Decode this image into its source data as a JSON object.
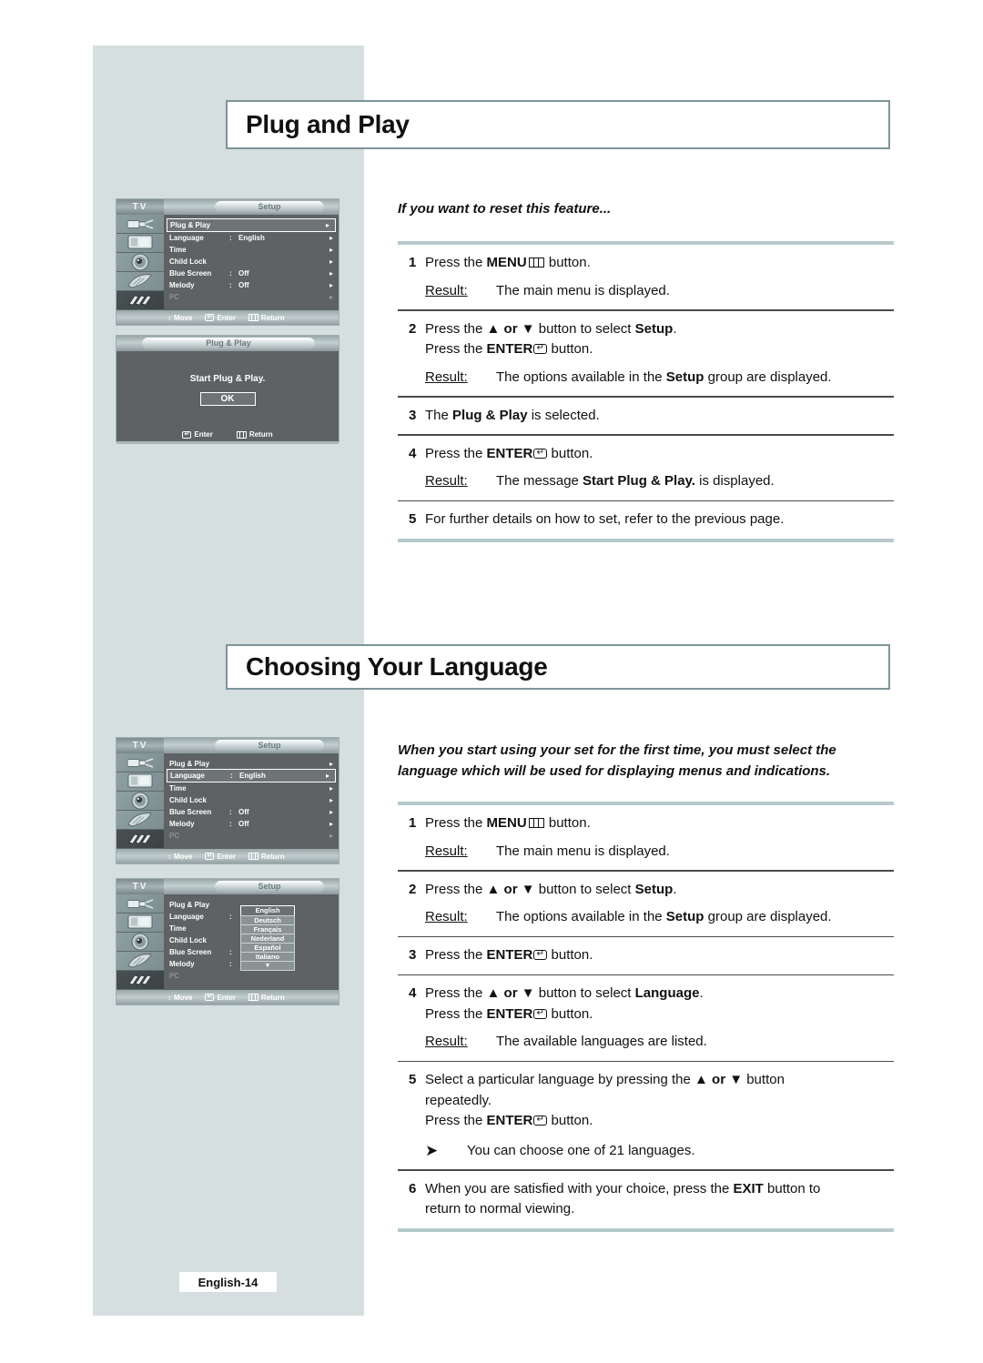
{
  "page": {
    "footer_label": "English-14"
  },
  "sections": [
    {
      "heading": "Plug and Play",
      "intro": "If you want to reset this feature...",
      "steps": [
        {
          "num": "1",
          "lines": [
            "Press the ",
            "MENU",
            " button."
          ],
          "text_pre": "Press the ",
          "bold": "MENU",
          "glyph": "menu-icon",
          "text_post": " button.",
          "result_label": "Result:",
          "result_text": "The main menu is displayed."
        },
        {
          "num": "2",
          "result_label": "Result:",
          "result_text_a": "The options available in the ",
          "result_bold": "Setup",
          "result_text_b": " group are displayed."
        },
        {
          "num": "3",
          "text_a": "The ",
          "bold": "Plug & Play",
          "text_b": " is selected."
        },
        {
          "num": "4",
          "text_pre": "Press the ",
          "bold": "ENTER",
          "text_post": " button.",
          "result_label": "Result:",
          "result_text_a": "The message ",
          "result_bold": "Start Plug & Play.",
          "result_text_b": " is displayed."
        },
        {
          "num": "5",
          "text": "For further details on how to set, refer to the previous page."
        }
      ]
    },
    {
      "heading": "Choosing Your Language",
      "intro_line1": "When you start using your set for the first time, you must select the",
      "intro_line2": "language which will be used for displaying menus and indications."
    }
  ],
  "steps_plug": {
    "s1_pre": "Press the ",
    "s1_bold": "MENU",
    "s1_post": " button.",
    "s1_result_label": "Result:",
    "s1_result": "The main menu is displayed.",
    "s2_pre": "Press the ",
    "s2_arrows": "▲ or ▼",
    "s2_mid": " button to select ",
    "s2_bold": "Setup",
    "s2_post": ".",
    "s2_l2_pre": "Press the ",
    "s2_l2_bold": "ENTER",
    "s2_l2_post": " button.",
    "s2_result_label": "Result:",
    "s2_result_a": "The options available in the ",
    "s2_result_bold": "Setup",
    "s2_result_b": " group are displayed.",
    "s3_a": "The ",
    "s3_bold": "Plug & Play",
    "s3_b": " is selected.",
    "s4_pre": "Press the ",
    "s4_bold": "ENTER",
    "s4_post": " button.",
    "s4_result_label": "Result:",
    "s4_result_a": "The message ",
    "s4_result_bold": "Start Plug & Play.",
    "s4_result_b": " is displayed.",
    "s5_text": "For further details on how to set, refer to the previous page.",
    "n1": "1",
    "n2": "2",
    "n3": "3",
    "n4": "4",
    "n5": "5"
  },
  "steps_lang": {
    "n1": "1",
    "n2": "2",
    "n3": "3",
    "n4": "4",
    "n5": "5",
    "n6": "6",
    "s1_pre": "Press the ",
    "s1_bold": "MENU",
    "s1_post": " button.",
    "s1_result_label": "Result:",
    "s1_result": "The main menu is displayed.",
    "s2_pre": "Press the ",
    "s2_arrows": "▲ or ▼",
    "s2_mid": " button to select ",
    "s2_bold": "Setup",
    "s2_post": ".",
    "s2_result_label": "Result:",
    "s2_result_a": "The options available in the ",
    "s2_result_bold": "Setup",
    "s2_result_b": " group are displayed.",
    "s3_pre": "Press the ",
    "s3_bold": "ENTER",
    "s3_post": " button.",
    "s4_pre": "Press the ",
    "s4_arrows": "▲ or ▼",
    "s4_mid": " button to select ",
    "s4_bold": "Language",
    "s4_post": ".",
    "s4_l2_pre": "Press the ",
    "s4_l2_bold": "ENTER",
    "s4_l2_post": " button.",
    "s4_result_label": "Result:",
    "s4_result": "The available languages are listed.",
    "s5_l1_a": "Select a particular language by pressing the ",
    "s5_l1_arrows": "▲ or ▼",
    "s5_l1_b": " button",
    "s5_l2": "repeatedly.",
    "s5_l3_pre": "Press the ",
    "s5_l3_bold": "ENTER",
    "s5_l3_post": " button.",
    "s5_note_arrow": "➤",
    "s5_note": "You can choose one of 21 languages.",
    "s6_a": "When you are satisfied with your choice, press the ",
    "s6_bold": "EXIT",
    "s6_b": " button to",
    "s6_l2": "return to normal viewing."
  },
  "osd": {
    "tv_label": "TV",
    "title": "Setup",
    "rows": [
      {
        "label": "Plug & Play",
        "colon": "",
        "value": "",
        "arrow": "▸"
      },
      {
        "label": "Language",
        "colon": ":",
        "value": "English",
        "arrow": "▸"
      },
      {
        "label": "Time",
        "colon": "",
        "value": "",
        "arrow": "▸"
      },
      {
        "label": "Child Lock",
        "colon": "",
        "value": "",
        "arrow": "▸"
      },
      {
        "label": "Blue Screen",
        "colon": ":",
        "value": "Off",
        "arrow": "▸"
      },
      {
        "label": "Melody",
        "colon": ":",
        "value": "Off",
        "arrow": "▸"
      },
      {
        "label": "PC",
        "colon": "",
        "value": "",
        "arrow": "▸"
      }
    ],
    "footer": {
      "move": "Move",
      "enter": "Enter",
      "return": "Return",
      "move_glyph": "↕"
    },
    "icons": [
      "plug-icon",
      "picture-icon",
      "sound-icon",
      "channel-icon",
      "setup-icon"
    ]
  },
  "osd_dialog": {
    "title": "Plug & Play",
    "message": "Start Plug & Play.",
    "ok": "OK",
    "enter": "Enter",
    "return": "Return"
  },
  "language_menu": {
    "items": [
      "English",
      "Deutsch",
      "Français",
      "Nederland",
      "Español",
      "Italiano"
    ],
    "more_glyph": "▼",
    "selected": "English"
  }
}
